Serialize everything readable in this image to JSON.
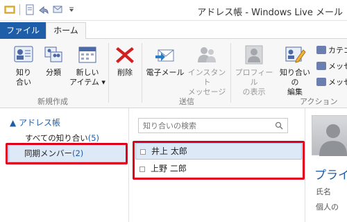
{
  "window": {
    "title": "アドレス帳 - Windows Live メール"
  },
  "tabs": {
    "file": "ファイル",
    "home": "ホーム"
  },
  "ribbon": {
    "new_group": {
      "label": "新規作成",
      "contact_line1": "知り",
      "contact_line2": "合い",
      "category_label": "分類",
      "new_item_line1": "新しい",
      "new_item_line2": "アイテム ▾"
    },
    "delete_label": "削除",
    "send_group": {
      "label": "送信",
      "email_line1": "電子メール",
      "im_line1": "インスタント",
      "im_line2": "メッセージ"
    },
    "action_group": {
      "label": "アクション",
      "profile_line1": "プロフィール",
      "profile_line2": "の表示",
      "edit_line1": "知り合いの",
      "edit_line2": "編集",
      "small1": "カテゴ",
      "small2": "メッセ",
      "small3": "メッセ"
    }
  },
  "nav": {
    "header": "▲ アドレス帳",
    "all_contacts": "すべての知り合い",
    "all_count": "(5)",
    "sync_members": "同期メンバー",
    "sync_count": "(2)"
  },
  "search": {
    "placeholder": "知り合いの検索"
  },
  "contacts": [
    {
      "name": "井上 太郎"
    },
    {
      "name": "上野 二郎"
    }
  ],
  "detail": {
    "title": "プライ",
    "field1": "氏名",
    "field2": "個人の"
  },
  "colors": {
    "accent": "#1e5ea8",
    "highlight": "#e0001b",
    "selection": "#dde9f7"
  }
}
